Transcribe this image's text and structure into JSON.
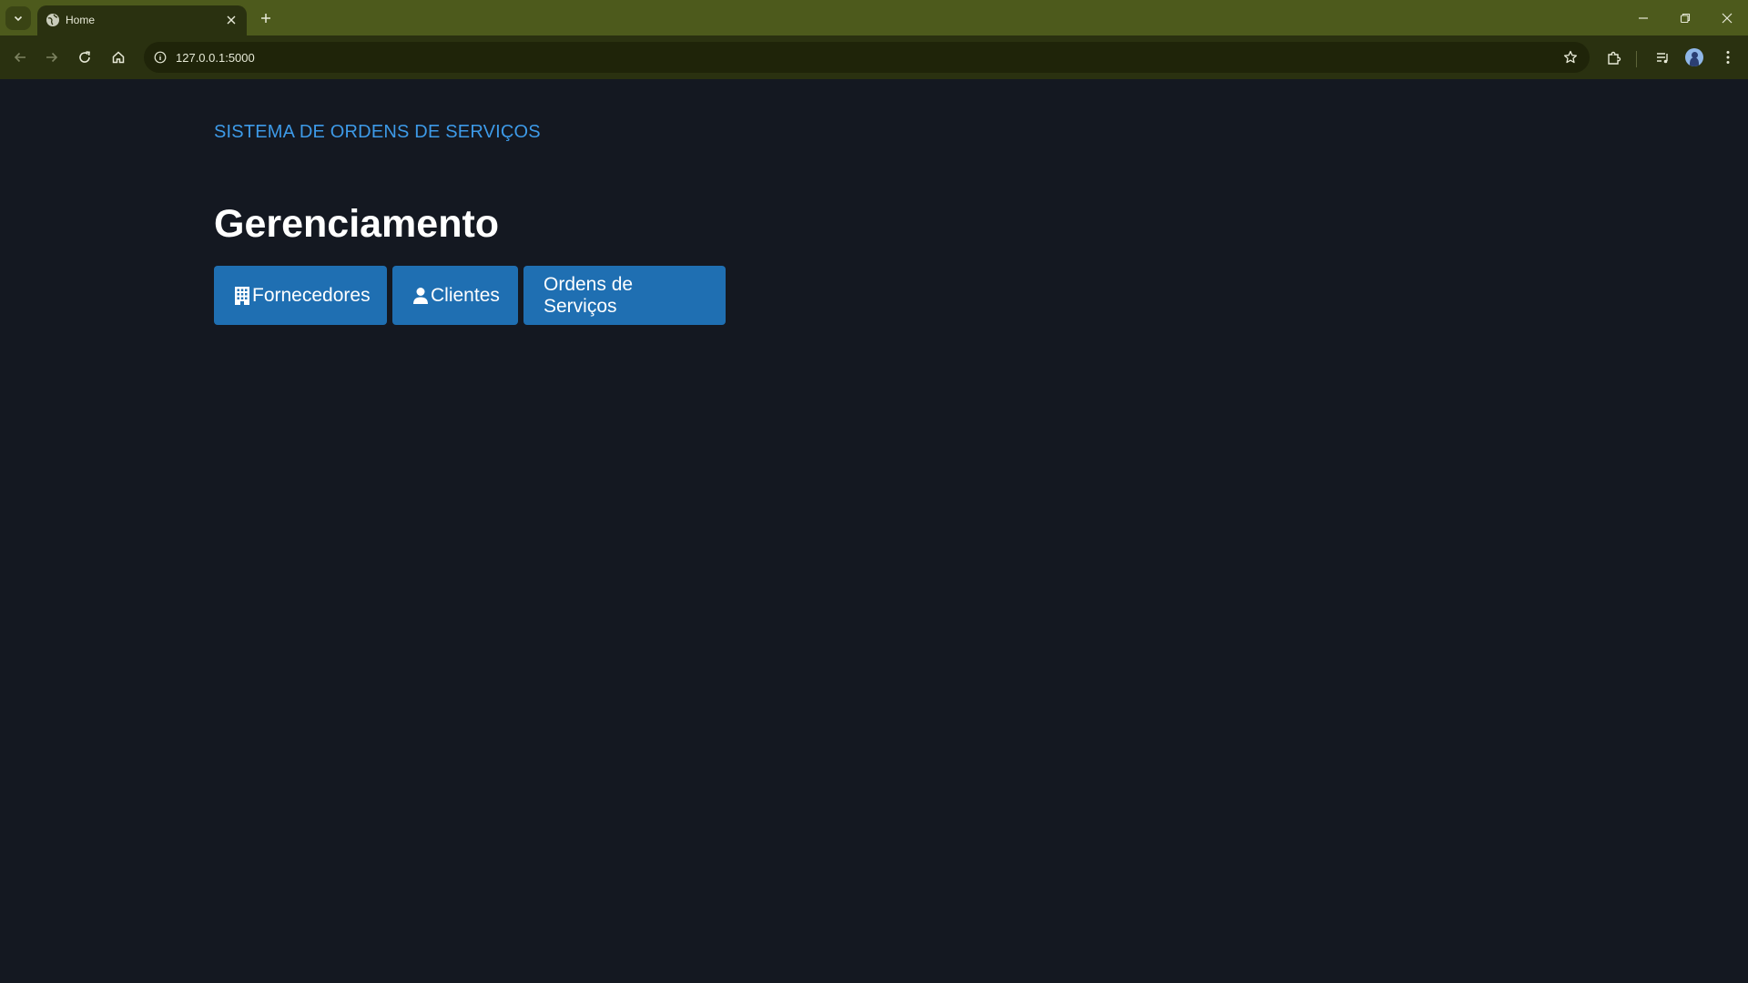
{
  "browser": {
    "tab": {
      "title": "Home"
    },
    "address_bar": {
      "url": "127.0.0.1:5000"
    },
    "icons": {
      "tab_search": "chevron-down-icon",
      "favicon": "globe-icon",
      "tab_close": "close-icon",
      "new_tab": "plus-icon",
      "back": "arrow-left-icon",
      "forward": "arrow-right-icon",
      "reload": "reload-icon",
      "home": "home-icon",
      "site_info": "info-icon",
      "bookmark": "star-icon",
      "extensions": "puzzle-icon",
      "media": "media-list-icon",
      "profile": "avatar",
      "menu": "kebab-menu-icon",
      "minimize": "minimize-icon",
      "restore": "restore-icon",
      "close_window": "close-icon"
    },
    "colors": {
      "frame": "#4d5a1c",
      "toolbar": "#2a3110"
    }
  },
  "page": {
    "brand": "SISTEMA DE ORDENS DE SERVIÇOS",
    "heading": "Gerenciamento",
    "buttons": [
      {
        "label": "Fornecedores",
        "icon": "building-icon"
      },
      {
        "label": "Clientes",
        "icon": "person-icon"
      },
      {
        "label": "Ordens de Serviços"
      }
    ],
    "colors": {
      "background": "#141821",
      "brand": "#3d9ae8",
      "button": "#1f6fb2",
      "heading": "#ffffff"
    }
  }
}
